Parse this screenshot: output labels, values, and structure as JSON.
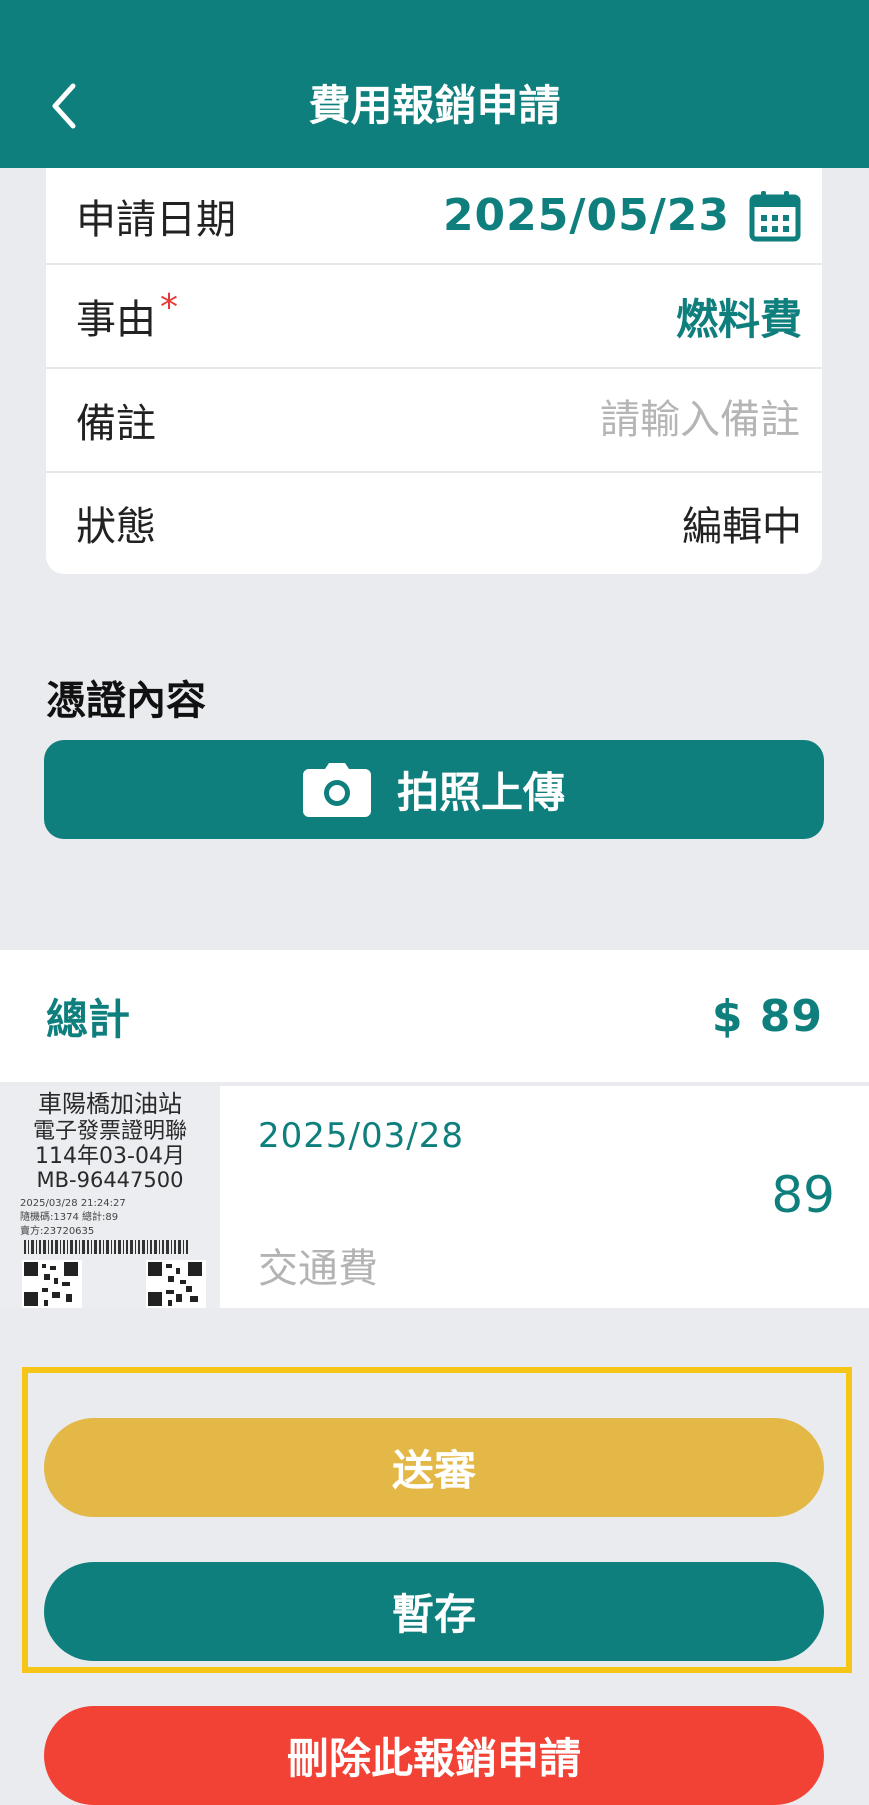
{
  "header": {
    "title": "費用報銷申請"
  },
  "form": {
    "date_label": "申請日期",
    "date_value": "2025/05/23",
    "reason_label": "事由",
    "required_mark": "*",
    "reason_value": "燃料費",
    "note_label": "備註",
    "note_value": "",
    "note_placeholder": "請輸入備註",
    "status_label": "狀態",
    "status_value": "編輯中"
  },
  "voucher": {
    "section_title": "憑證內容",
    "upload_label": "拍照上傳"
  },
  "summary": {
    "total_label": "總計",
    "total_value": "$ 89"
  },
  "items": [
    {
      "date": "2025/03/28",
      "amount": "89",
      "category": "交通費",
      "receipt_lines": [
        "車陽橋加油站",
        "電子發票證明聯",
        "114年03-04月",
        "MB-96447500",
        "2025/03/28 21:24:27",
        "隨機碼:1374    總計:89",
        "賣方:23720635"
      ]
    }
  ],
  "actions": {
    "submit_label": "送審",
    "save_label": "暫存",
    "delete_label": "刪除此報銷申請"
  },
  "colors": {
    "primary": "#0f7f7d",
    "submit": "#e3b847",
    "delete": "#f24236",
    "highlight": "#f5c518",
    "background": "#e9ebef"
  }
}
